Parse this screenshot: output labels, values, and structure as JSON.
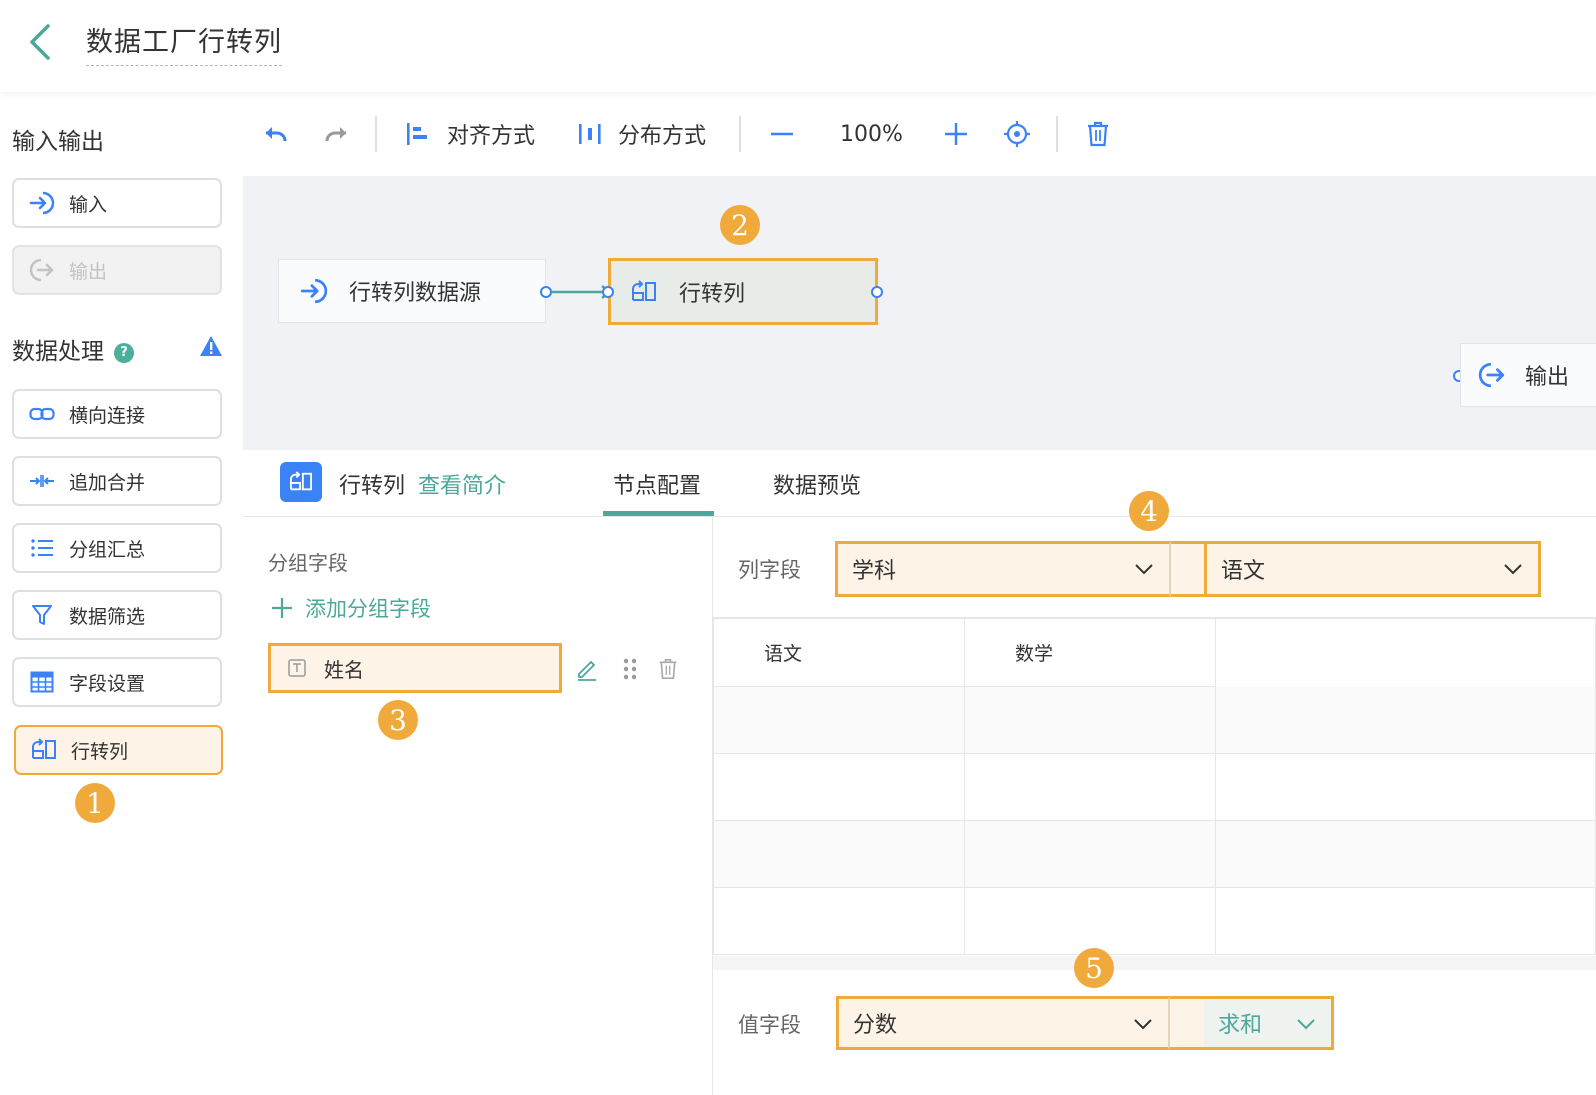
{
  "header": {
    "title": "数据工厂行转列"
  },
  "sidebar": {
    "io_title": "输入输出",
    "io_items": [
      {
        "label": "输入",
        "icon": "input-arrow-icon",
        "disabled": false
      },
      {
        "label": "输出",
        "icon": "output-arrow-icon",
        "disabled": true
      }
    ],
    "proc_title": "数据处理",
    "proc_items": [
      {
        "label": "横向连接",
        "icon": "link-icon"
      },
      {
        "label": "追加合并",
        "icon": "merge-icon"
      },
      {
        "label": "分组汇总",
        "icon": "list-icon"
      },
      {
        "label": "数据筛选",
        "icon": "filter-icon"
      },
      {
        "label": "字段设置",
        "icon": "table-icon"
      },
      {
        "label": "行转列",
        "icon": "pivot-icon"
      }
    ]
  },
  "toolbar": {
    "align_label": "对齐方式",
    "distribute_label": "分布方式",
    "zoom": "100%"
  },
  "canvas": {
    "nodes": [
      {
        "label": "行转列数据源",
        "icon": "input-arrow-icon"
      },
      {
        "label": "行转列",
        "icon": "pivot-icon"
      },
      {
        "label": "输出",
        "icon": "output-arrow-icon"
      }
    ]
  },
  "panel": {
    "node_name": "行转列",
    "intro_link": "查看简介",
    "tabs": [
      "节点配置",
      "数据预览"
    ],
    "group_title": "分组字段",
    "add_group": "添加分组字段",
    "group_field": "姓名",
    "column_label": "列字段",
    "column_field": "学科",
    "column_value": "语文",
    "columns": [
      "语文",
      "数学"
    ],
    "value_label": "值字段",
    "value_field": "分数",
    "aggregate": "求和"
  },
  "badges": [
    "1",
    "2",
    "3",
    "4",
    "5"
  ],
  "colors": {
    "accent": "#4ba89a",
    "highlight": "#f0a93b",
    "highlight_bg": "#fdf4e7",
    "blue": "#3b82f6"
  }
}
